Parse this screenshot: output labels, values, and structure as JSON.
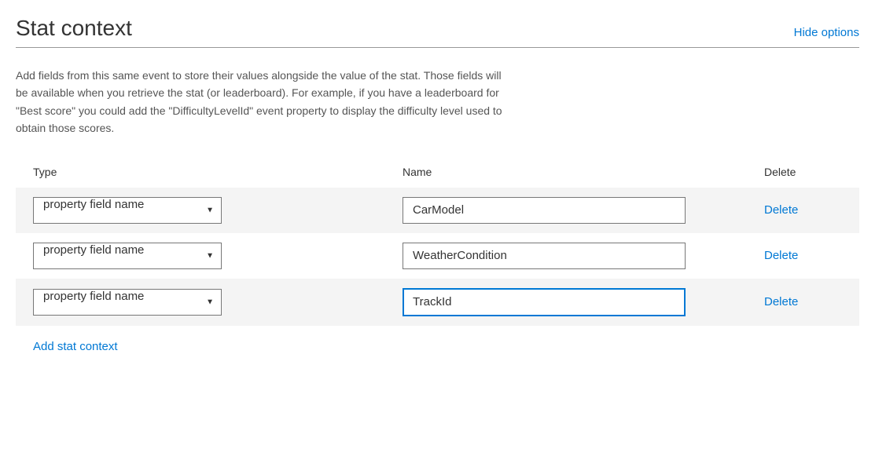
{
  "header": {
    "title": "Stat context",
    "hide_options": "Hide options"
  },
  "description": "Add fields from this same event to store their values alongside the value of the stat. Those fields will be available when you retrieve the stat (or leaderboard). For example, if you have a leaderboard for \"Best score\" you could add the \"DifficultyLevelId\" event property to display the difficulty level used to obtain those scores.",
  "columns": {
    "type": "Type",
    "name": "Name",
    "delete": "Delete"
  },
  "select_label": "property field name",
  "rows": [
    {
      "name_value": "CarModel",
      "delete_label": "Delete",
      "focused": false
    },
    {
      "name_value": "WeatherCondition",
      "delete_label": "Delete",
      "focused": false
    },
    {
      "name_value": "TrackId",
      "delete_label": "Delete",
      "focused": true
    }
  ],
  "add_label": "Add stat context"
}
